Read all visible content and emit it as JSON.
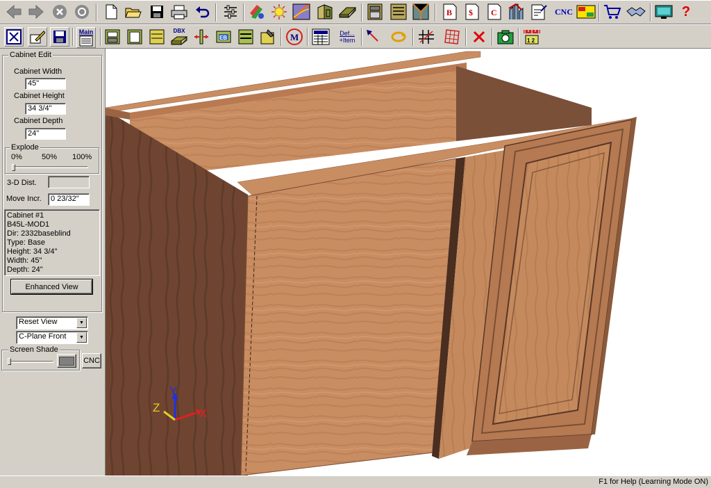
{
  "toolbar_main": {
    "buttons": [
      {
        "name": "back-icon"
      },
      {
        "name": "forward-icon"
      },
      {
        "name": "stop-icon"
      },
      {
        "name": "refresh-icon"
      },
      {
        "name": "new-file-icon"
      },
      {
        "name": "open-folder-icon"
      },
      {
        "name": "save-icon"
      },
      {
        "name": "print-icon"
      },
      {
        "name": "undo-icon"
      },
      {
        "name": "settings-sliders-icon"
      },
      {
        "name": "material-swatch-icon"
      },
      {
        "name": "light-icon"
      },
      {
        "name": "render-icon"
      },
      {
        "name": "door-style-icon"
      },
      {
        "name": "panel-icon"
      },
      {
        "name": "cabinet-icon"
      },
      {
        "name": "cabinet-list-icon"
      },
      {
        "name": "room-icon"
      },
      {
        "name": "bid-report-icon"
      },
      {
        "name": "cost-report-icon"
      },
      {
        "name": "cutlist-report-icon"
      },
      {
        "name": "optimize-icon"
      },
      {
        "name": "export-icon"
      }
    ],
    "cnc_label": "CNC",
    "tail": [
      {
        "name": "shopping-cart-icon"
      },
      {
        "name": "handshake-icon"
      },
      {
        "name": "monitor-icon"
      },
      {
        "name": "help-icon"
      }
    ],
    "help_glyph": "?"
  },
  "toolbar_edit": {
    "main_label": "Main",
    "dbx_label": "DBX",
    "eb_label": "EB",
    "m_label": "M",
    "def_label_1": "Def...",
    "def_label_2": "+Item"
  },
  "side": {
    "group_title": "Cabinet Edit",
    "width_label": "Cabinet Width",
    "width_value": "45\"",
    "height_label": "Cabinet Height",
    "height_value": "34 3/4\"",
    "depth_label": "Cabinet Depth",
    "depth_value": "24\"",
    "explode_title": "Explode",
    "explode_ticks": [
      "0%",
      "50%",
      "100%"
    ],
    "explode_level": 0,
    "dist_label": "3-D Dist.",
    "dist_value": "",
    "move_label": "Move Incr.",
    "move_value": "0 23/32\"",
    "info_lines": [
      "Cabinet #1",
      "B45L-MOD1",
      "Dir: 2332baseblind",
      "Type: Base",
      "Height: 34 3/4\"",
      "Width: 45\"",
      "Depth: 24\""
    ],
    "enhanced_button": "Enhanced View",
    "reset_view": "Reset View",
    "cplane": "C-Plane Front",
    "shade_title": "Screen Shade",
    "cnc_button": "CNC"
  },
  "viewport": {
    "axis_x": "X",
    "axis_y": "Y",
    "axis_z": "Z",
    "colors": {
      "wood": "#c98d62",
      "wood_dark": "#a86e4a",
      "side_dark": "#6f4532",
      "interior": "#7a5038"
    }
  },
  "status": {
    "text": "F1 for Help (Learning Mode ON)"
  }
}
